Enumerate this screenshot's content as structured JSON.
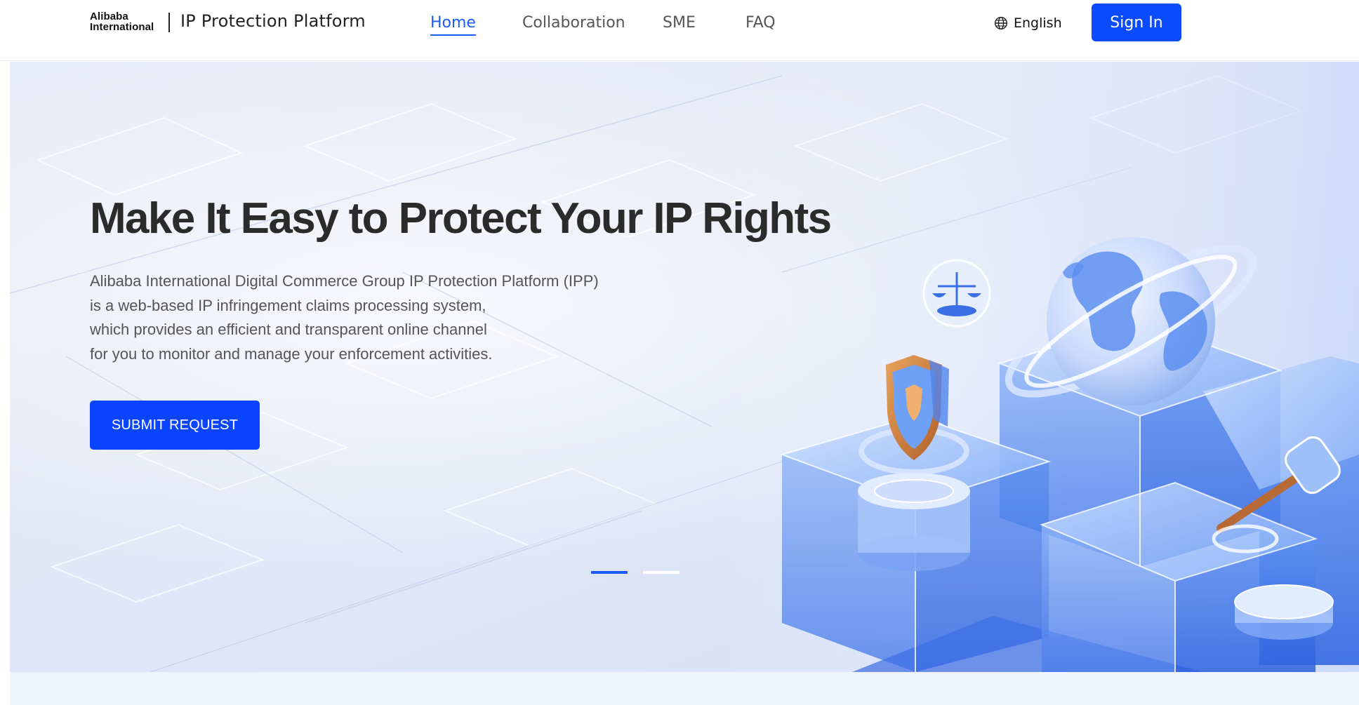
{
  "header": {
    "logo_line1": "Alibaba",
    "logo_line2": "International",
    "platform_title": "IP Protection Platform",
    "nav": [
      {
        "label": "Home",
        "active": true
      },
      {
        "label": "Collaboration",
        "active": false
      },
      {
        "label": "SME",
        "active": false
      },
      {
        "label": "FAQ",
        "active": false
      }
    ],
    "language": {
      "icon": "globe-icon",
      "label": "English"
    },
    "signin_label": "Sign In"
  },
  "hero": {
    "title": "Make It Easy to Protect Your IP Rights",
    "description_lines": [
      "Alibaba International Digital Commerce Group IP Protection Platform (IPP)",
      "is a web-based IP infringement claims processing system,",
      "which provides an efficient and transparent online channel",
      "for you to monitor and manage your enforcement activities."
    ],
    "cta_label": "SUBMIT REQUEST",
    "carousel": {
      "slides": 2,
      "active_index": 0
    }
  },
  "colors": {
    "primary": "#0a4bff",
    "nav_active": "#1a5cff",
    "title_text": "#2b2b2b",
    "body_text": "#555555"
  }
}
